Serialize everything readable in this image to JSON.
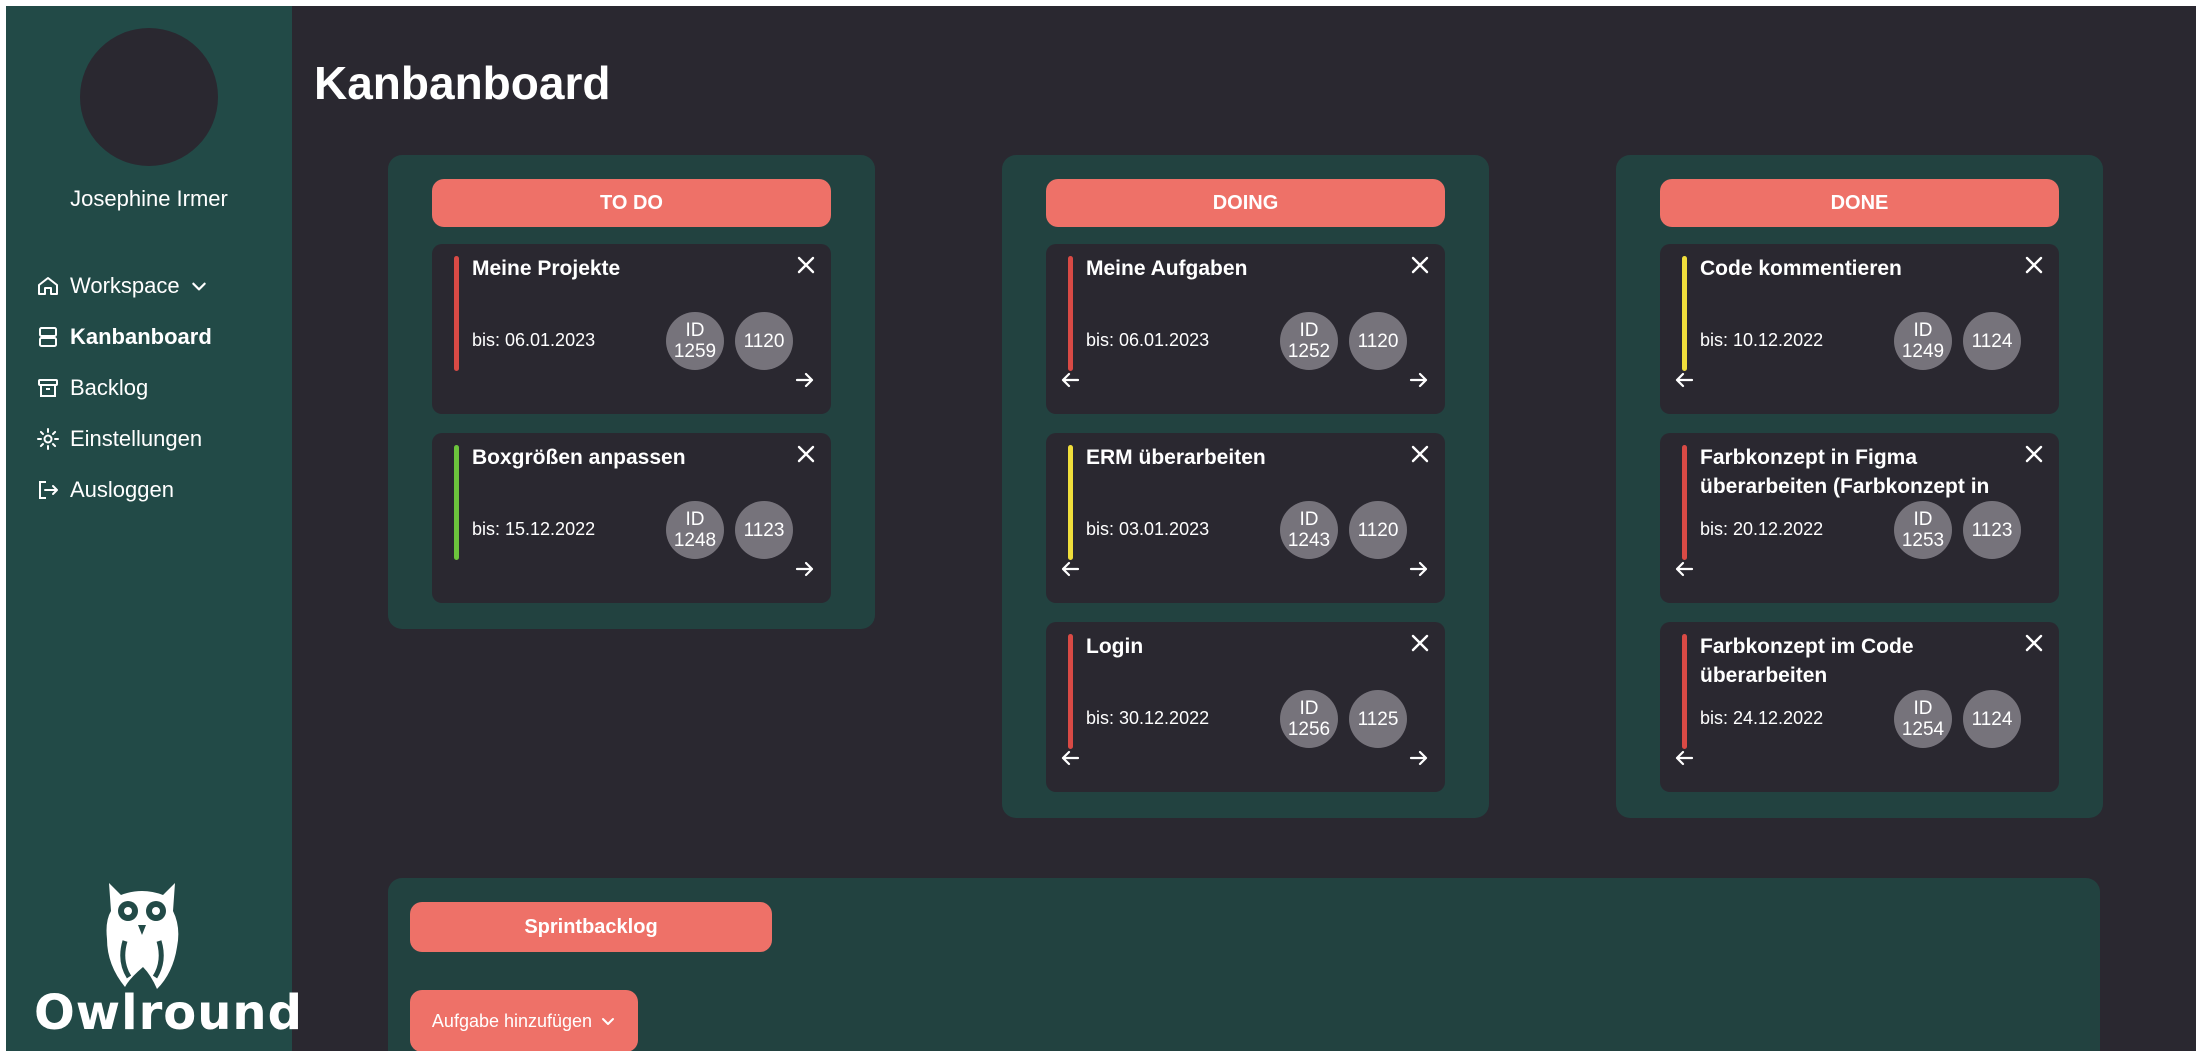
{
  "user": {
    "name": "Josephine Irmer"
  },
  "nav": [
    {
      "label": "Workspace",
      "icon": "home-icon",
      "has_dropdown": true
    },
    {
      "label": "Kanbanboard",
      "icon": "kanban-icon",
      "active": true
    },
    {
      "label": "Backlog",
      "icon": "archive-icon"
    },
    {
      "label": "Einstellungen",
      "icon": "gear-icon"
    },
    {
      "label": "Ausloggen",
      "icon": "logout-icon"
    }
  ],
  "brand": {
    "name": "Owlround"
  },
  "page": {
    "title": "Kanbanboard"
  },
  "colors": {
    "sidebar": "#224a47",
    "background": "#2a2830",
    "panel": "#224240",
    "accent": "#ee7168",
    "badge": "#76737b",
    "priority_high": "#d94a45",
    "priority_medium": "#f0de3b",
    "priority_low": "#6cc43c"
  },
  "columns": [
    {
      "header": "TO DO",
      "cards": [
        {
          "title": "Meine Projekte",
          "due": "bis: 06.01.2023",
          "id_label": "ID",
          "id": "1259",
          "number": "1120",
          "priority": "high",
          "prev": false,
          "next": true
        },
        {
          "title": "Boxgrößen anpassen",
          "due": "bis: 15.12.2022",
          "id_label": "ID",
          "id": "1248",
          "number": "1123",
          "priority": "low",
          "prev": false,
          "next": true
        }
      ]
    },
    {
      "header": "DOING",
      "cards": [
        {
          "title": "Meine Aufgaben",
          "due": "bis: 06.01.2023",
          "id_label": "ID",
          "id": "1252",
          "number": "1120",
          "priority": "high",
          "prev": true,
          "next": true
        },
        {
          "title": "ERM überarbeiten",
          "due": "bis: 03.01.2023",
          "id_label": "ID",
          "id": "1243",
          "number": "1120",
          "priority": "medium",
          "prev": true,
          "next": true
        },
        {
          "title": "Login",
          "due": "bis: 30.12.2022",
          "id_label": "ID",
          "id": "1256",
          "number": "1125",
          "priority": "high",
          "prev": true,
          "next": true
        }
      ]
    },
    {
      "header": "DONE",
      "cards": [
        {
          "title": "Code kommentieren",
          "due": "bis: 10.12.2022",
          "id_label": "ID",
          "id": "1249",
          "number": "1124",
          "priority": "medium",
          "prev": true,
          "next": false
        },
        {
          "title": "Farbkonzept in Figma überarbeiten (Farbkonzept in",
          "due": "bis: 20.12.2022",
          "id_label": "ID",
          "id": "1253",
          "number": "1123",
          "priority": "high",
          "prev": true,
          "next": false
        },
        {
          "title": "Farbkonzept im Code überarbeiten",
          "due": "bis: 24.12.2022",
          "id_label": "ID",
          "id": "1254",
          "number": "1124",
          "priority": "high",
          "prev": true,
          "next": false
        }
      ]
    }
  ],
  "sprint": {
    "header": "Sprintbacklog",
    "add_button": "Aufgabe hinzufügen"
  }
}
